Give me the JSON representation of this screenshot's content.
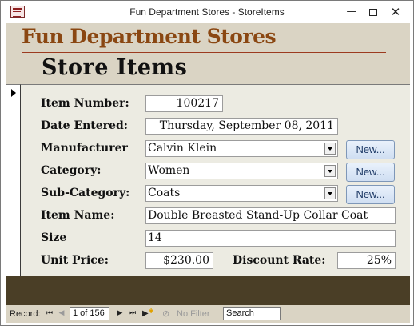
{
  "window": {
    "title": "Fun Department Stores - StoreItems",
    "minimize_glyph": "—",
    "close_glyph": "✕"
  },
  "header": {
    "company": "Fun Department Stores",
    "form_title": "Store Items"
  },
  "fields": {
    "item_number": {
      "label": "Item Number:",
      "value": "100217"
    },
    "date_entered": {
      "label": "Date Entered:",
      "value": "Thursday, September 08, 2011"
    },
    "manufacturer": {
      "label": "Manufacturer",
      "value": "Calvin Klein"
    },
    "category": {
      "label": "Category:",
      "value": "Women"
    },
    "sub_category": {
      "label": "Sub-Category:",
      "value": "Coats"
    },
    "item_name": {
      "label": "Item Name:",
      "value": "Double Breasted Stand-Up Collar Coat"
    },
    "size": {
      "label": "Size",
      "value": "14"
    },
    "unit_price": {
      "label": "Unit Price:",
      "value": "$230.00"
    },
    "discount_rate": {
      "label": "Discount Rate:",
      "value": "25%"
    }
  },
  "buttons": {
    "new_label": "New..."
  },
  "navigation": {
    "record_label": "Record:",
    "first_glyph": "⏮",
    "prev_glyph": "◀",
    "next_glyph": "▶",
    "last_glyph": "⏭",
    "new_glyph": "▶",
    "new_star": "✱",
    "current": "1 of 156",
    "filter_icon": "filter-off-icon",
    "filter_glyph": "⊘",
    "filter_label": "No Filter",
    "search": "Search"
  },
  "colors": {
    "header_bg": "#dad4c4",
    "company_text": "#8a4712",
    "detail_bg": "#ecebe2",
    "footer_bg": "#4a3e26"
  }
}
